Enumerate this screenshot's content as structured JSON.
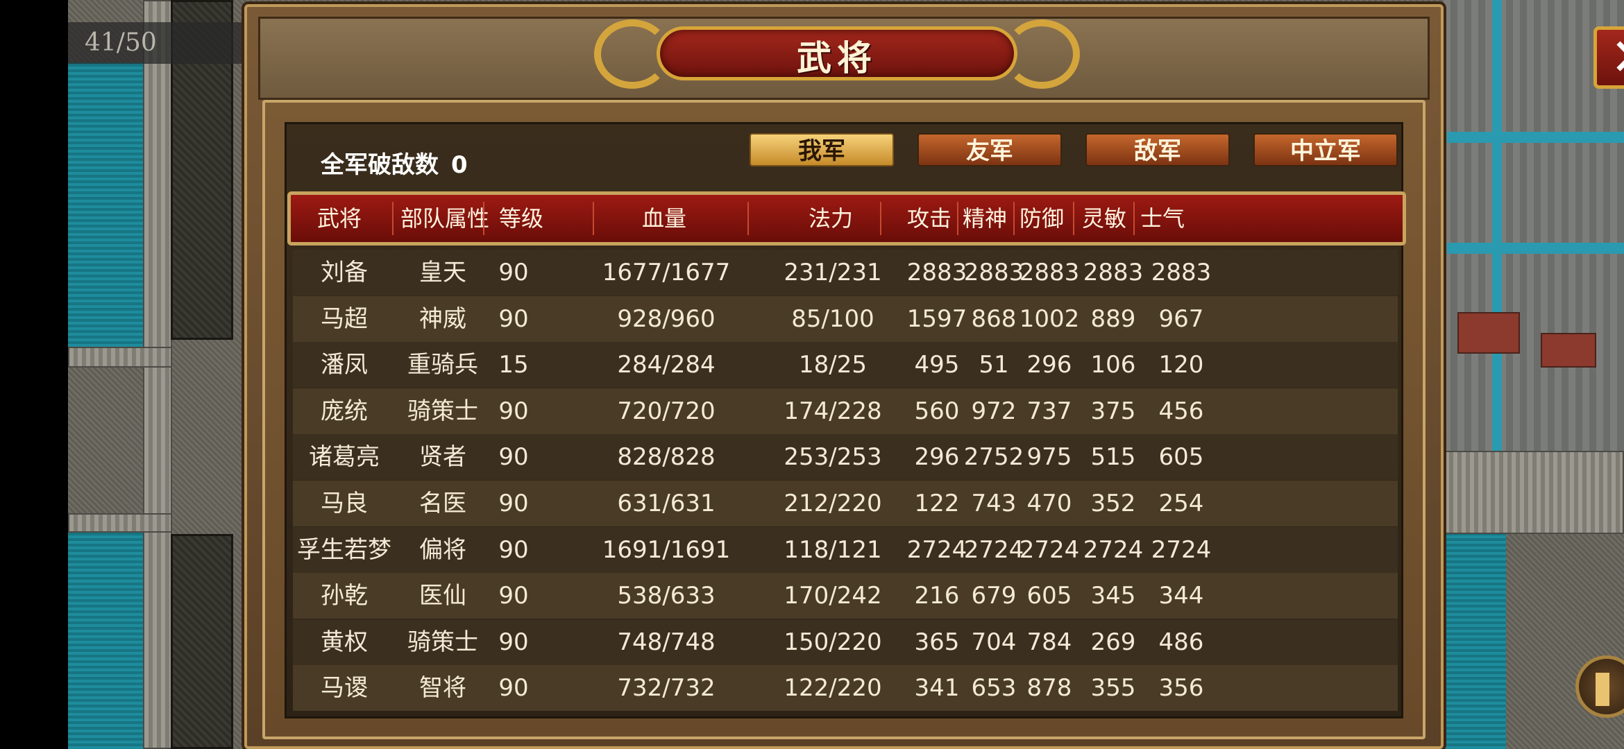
{
  "hud": {
    "counter": "41/50"
  },
  "dialog": {
    "title": "武将",
    "close_label": "✕",
    "kills_label": "全军破敌数",
    "kills_value": "0",
    "tabs": [
      {
        "label": "我军",
        "active": true
      },
      {
        "label": "友军",
        "active": false
      },
      {
        "label": "敌军",
        "active": false
      },
      {
        "label": "中立军",
        "active": false
      }
    ],
    "columns": [
      "武将",
      "部队属性",
      "等级",
      "血量",
      "法力",
      "攻击",
      "精神",
      "防御",
      "灵敏",
      "士气"
    ],
    "rows": [
      [
        "刘备",
        "皇天",
        "90",
        "1677/1677",
        "231/231",
        "2883",
        "2883",
        "2883",
        "2883",
        "2883"
      ],
      [
        "马超",
        "神威",
        "90",
        "928/960",
        "85/100",
        "1597",
        "868",
        "1002",
        "889",
        "967"
      ],
      [
        "潘凤",
        "重骑兵",
        "15",
        "284/284",
        "18/25",
        "495",
        "51",
        "296",
        "106",
        "120"
      ],
      [
        "庞统",
        "骑策士",
        "90",
        "720/720",
        "174/228",
        "560",
        "972",
        "737",
        "375",
        "456"
      ],
      [
        "诸葛亮",
        "贤者",
        "90",
        "828/828",
        "253/253",
        "296",
        "2752",
        "975",
        "515",
        "605"
      ],
      [
        "马良",
        "名医",
        "90",
        "631/631",
        "212/220",
        "122",
        "743",
        "470",
        "352",
        "254"
      ],
      [
        "孚生若梦",
        "偏将",
        "90",
        "1691/1691",
        "118/121",
        "2724",
        "2724",
        "2724",
        "2724",
        "2724"
      ],
      [
        "孙乾",
        "医仙",
        "90",
        "538/633",
        "170/242",
        "216",
        "679",
        "605",
        "345",
        "344"
      ],
      [
        "黄权",
        "骑策士",
        "90",
        "748/748",
        "150/220",
        "365",
        "704",
        "784",
        "269",
        "486"
      ],
      [
        "马谡",
        "智将",
        "90",
        "732/732",
        "122/220",
        "341",
        "653",
        "878",
        "355",
        "356"
      ]
    ]
  }
}
